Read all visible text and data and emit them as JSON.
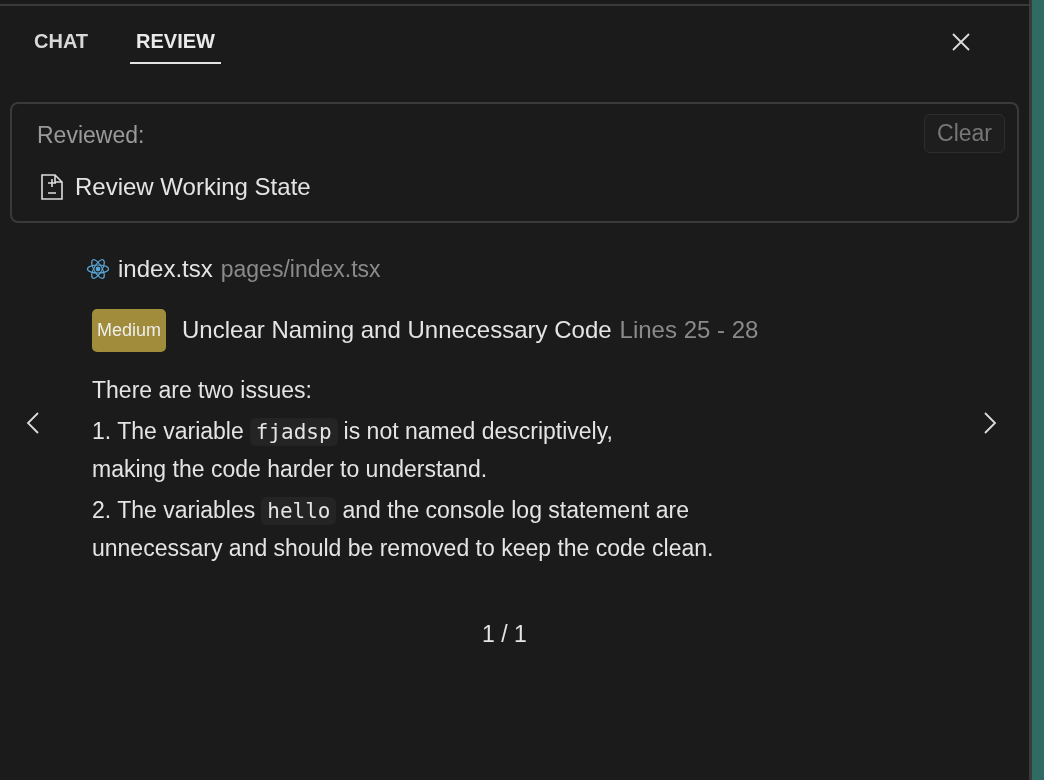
{
  "tabs": [
    {
      "label": "CHAT",
      "selected": false
    },
    {
      "label": "REVIEW",
      "selected": true
    }
  ],
  "reviewed": {
    "label": "Reviewed:",
    "item": "Review Working State",
    "clear_button": "Clear"
  },
  "file": {
    "name": "index.tsx",
    "path": "pages/index.tsx"
  },
  "issue": {
    "severity": "Medium",
    "color": "#a08c3a",
    "title": "Unclear Naming and Unnecessary Code",
    "lines": "Lines 25 - 28"
  },
  "description": [
    [
      [
        {
          "kind": "text",
          "text": "There are two issues:"
        }
      ]
    ],
    [
      [
        {
          "kind": "text",
          "text": "1. The variable"
        },
        {
          "kind": "code",
          "text": "fjadsp"
        },
        {
          "kind": "text",
          "text": "is not named descriptively,"
        }
      ],
      [
        {
          "kind": "text",
          "text": "making the code harder to understand."
        }
      ]
    ],
    [
      [
        {
          "kind": "text",
          "text": "2. The variables"
        },
        {
          "kind": "code",
          "text": "hello"
        },
        {
          "kind": "text",
          "text": "and the console log statement are"
        }
      ],
      [
        {
          "kind": "text",
          "text": "unnecessary and should be removed to keep the code clean."
        }
      ]
    ]
  ],
  "pager": "1 / 1"
}
